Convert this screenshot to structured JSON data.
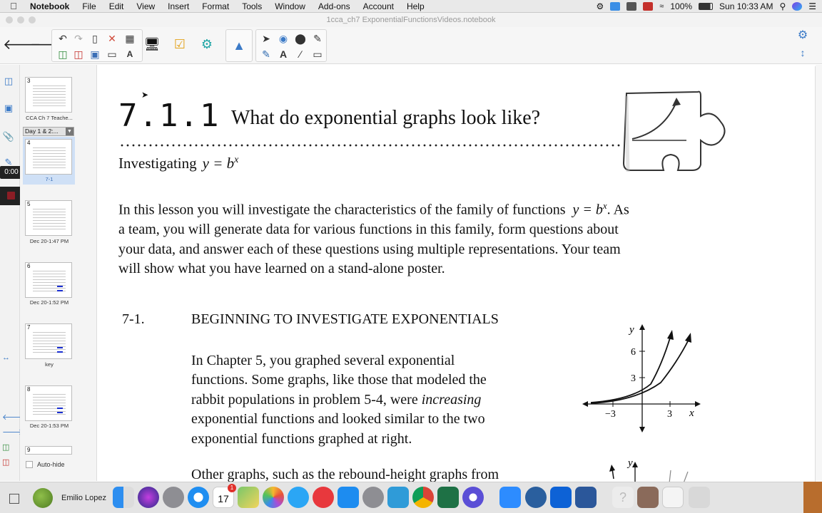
{
  "menubar": {
    "app": "Notebook",
    "items": [
      "File",
      "Edit",
      "View",
      "Insert",
      "Format",
      "Tools",
      "Window",
      "Add-ons",
      "Account",
      "Help"
    ],
    "battery": "100%",
    "clock": "Sun 10:33 AM"
  },
  "window": {
    "title": "1cca_ch7 ExponentialFunctionsVideos.notebook"
  },
  "recording": {
    "timer": "0:00"
  },
  "sorter": {
    "group_select": "Day 1 & 2:...",
    "pages": [
      {
        "num": "3",
        "caption": "CCA Ch 7 Teache..."
      },
      {
        "num": "4",
        "caption": "7-1",
        "selected": true
      },
      {
        "num": "5",
        "caption": "Dec 20-1:47 PM"
      },
      {
        "num": "6",
        "caption": "Dec 20-1:52 PM"
      },
      {
        "num": "7",
        "caption": "key"
      },
      {
        "num": "8",
        "caption": "Dec 20-1:53 PM"
      },
      {
        "num": "9",
        "caption": ""
      }
    ],
    "autohide": "Auto-hide"
  },
  "page": {
    "lesson_number": "7.1.1",
    "lesson_title": "What do exponential graphs look like?",
    "subheading": "Investigating",
    "subheading_eq": "y = b",
    "exp": "x",
    "intro_lines": [
      "In this lesson you will investigate the characteristics of the family of functions",
      ". As",
      "a team, you will generate data for various functions in this family, form questions about",
      "your data, and answer each of these questions using multiple representations.  Your team",
      "will show what you have learned on a stand-alone poster."
    ],
    "intro_eq": "y = b",
    "problem_number": "7-1.",
    "problem_title": "BEGINNING TO INVESTIGATE EXPONENTIALS",
    "problem_body": [
      "In Chapter 5, you graphed several exponential",
      "functions.  Some graphs, like those that modeled the",
      "rabbit populations in problem 5-4, were",
      "increasing",
      "exponential functions and looked similar to the two",
      "exponential functions graphed at right."
    ],
    "problem_body_next": "Other graphs, such as the rebound-height graphs from",
    "graph": {
      "y_label": "y",
      "x_label": "x",
      "y_ticks": [
        "6",
        "3"
      ],
      "x_ticks": [
        "−3",
        "3"
      ]
    },
    "graph2": {
      "y_label": "y"
    }
  },
  "dock": {
    "user": "Emilio Lopez",
    "badge": "1",
    "calendar_day": "17"
  }
}
